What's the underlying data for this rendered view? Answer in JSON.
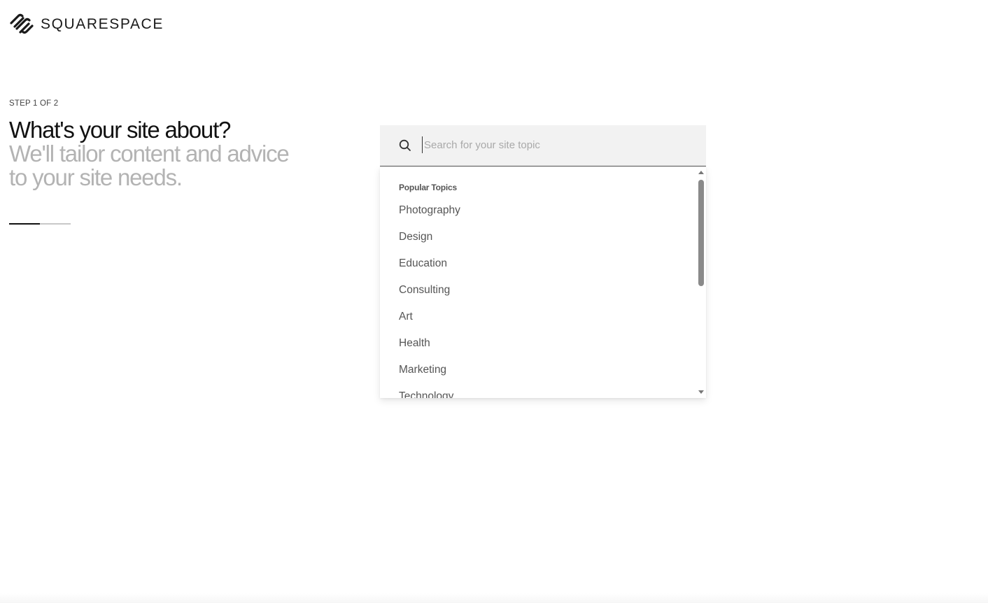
{
  "brand": {
    "name": "SQUARESPACE",
    "logo_icon": "squarespace-logo-icon"
  },
  "intro": {
    "step_label": "STEP 1 OF 2",
    "heading": "What's your site about?",
    "subheading": "We'll tailor content and advice to your site needs.",
    "progress_fraction": 0.5
  },
  "search": {
    "placeholder": "Search for your site topic",
    "value": "",
    "icon": "search-icon"
  },
  "dropdown": {
    "section_title": "Popular Topics",
    "topics": [
      "Photography",
      "Design",
      "Education",
      "Consulting",
      "Art",
      "Health",
      "Marketing",
      "Technology"
    ],
    "scroll_position_fraction": 0.0
  },
  "colors": {
    "heading": "#111111",
    "subheading": "#b3b3b3",
    "search_bg": "#f2f2f2",
    "topic_text": "#555555",
    "scroll_thumb": "#8a8a8a"
  }
}
